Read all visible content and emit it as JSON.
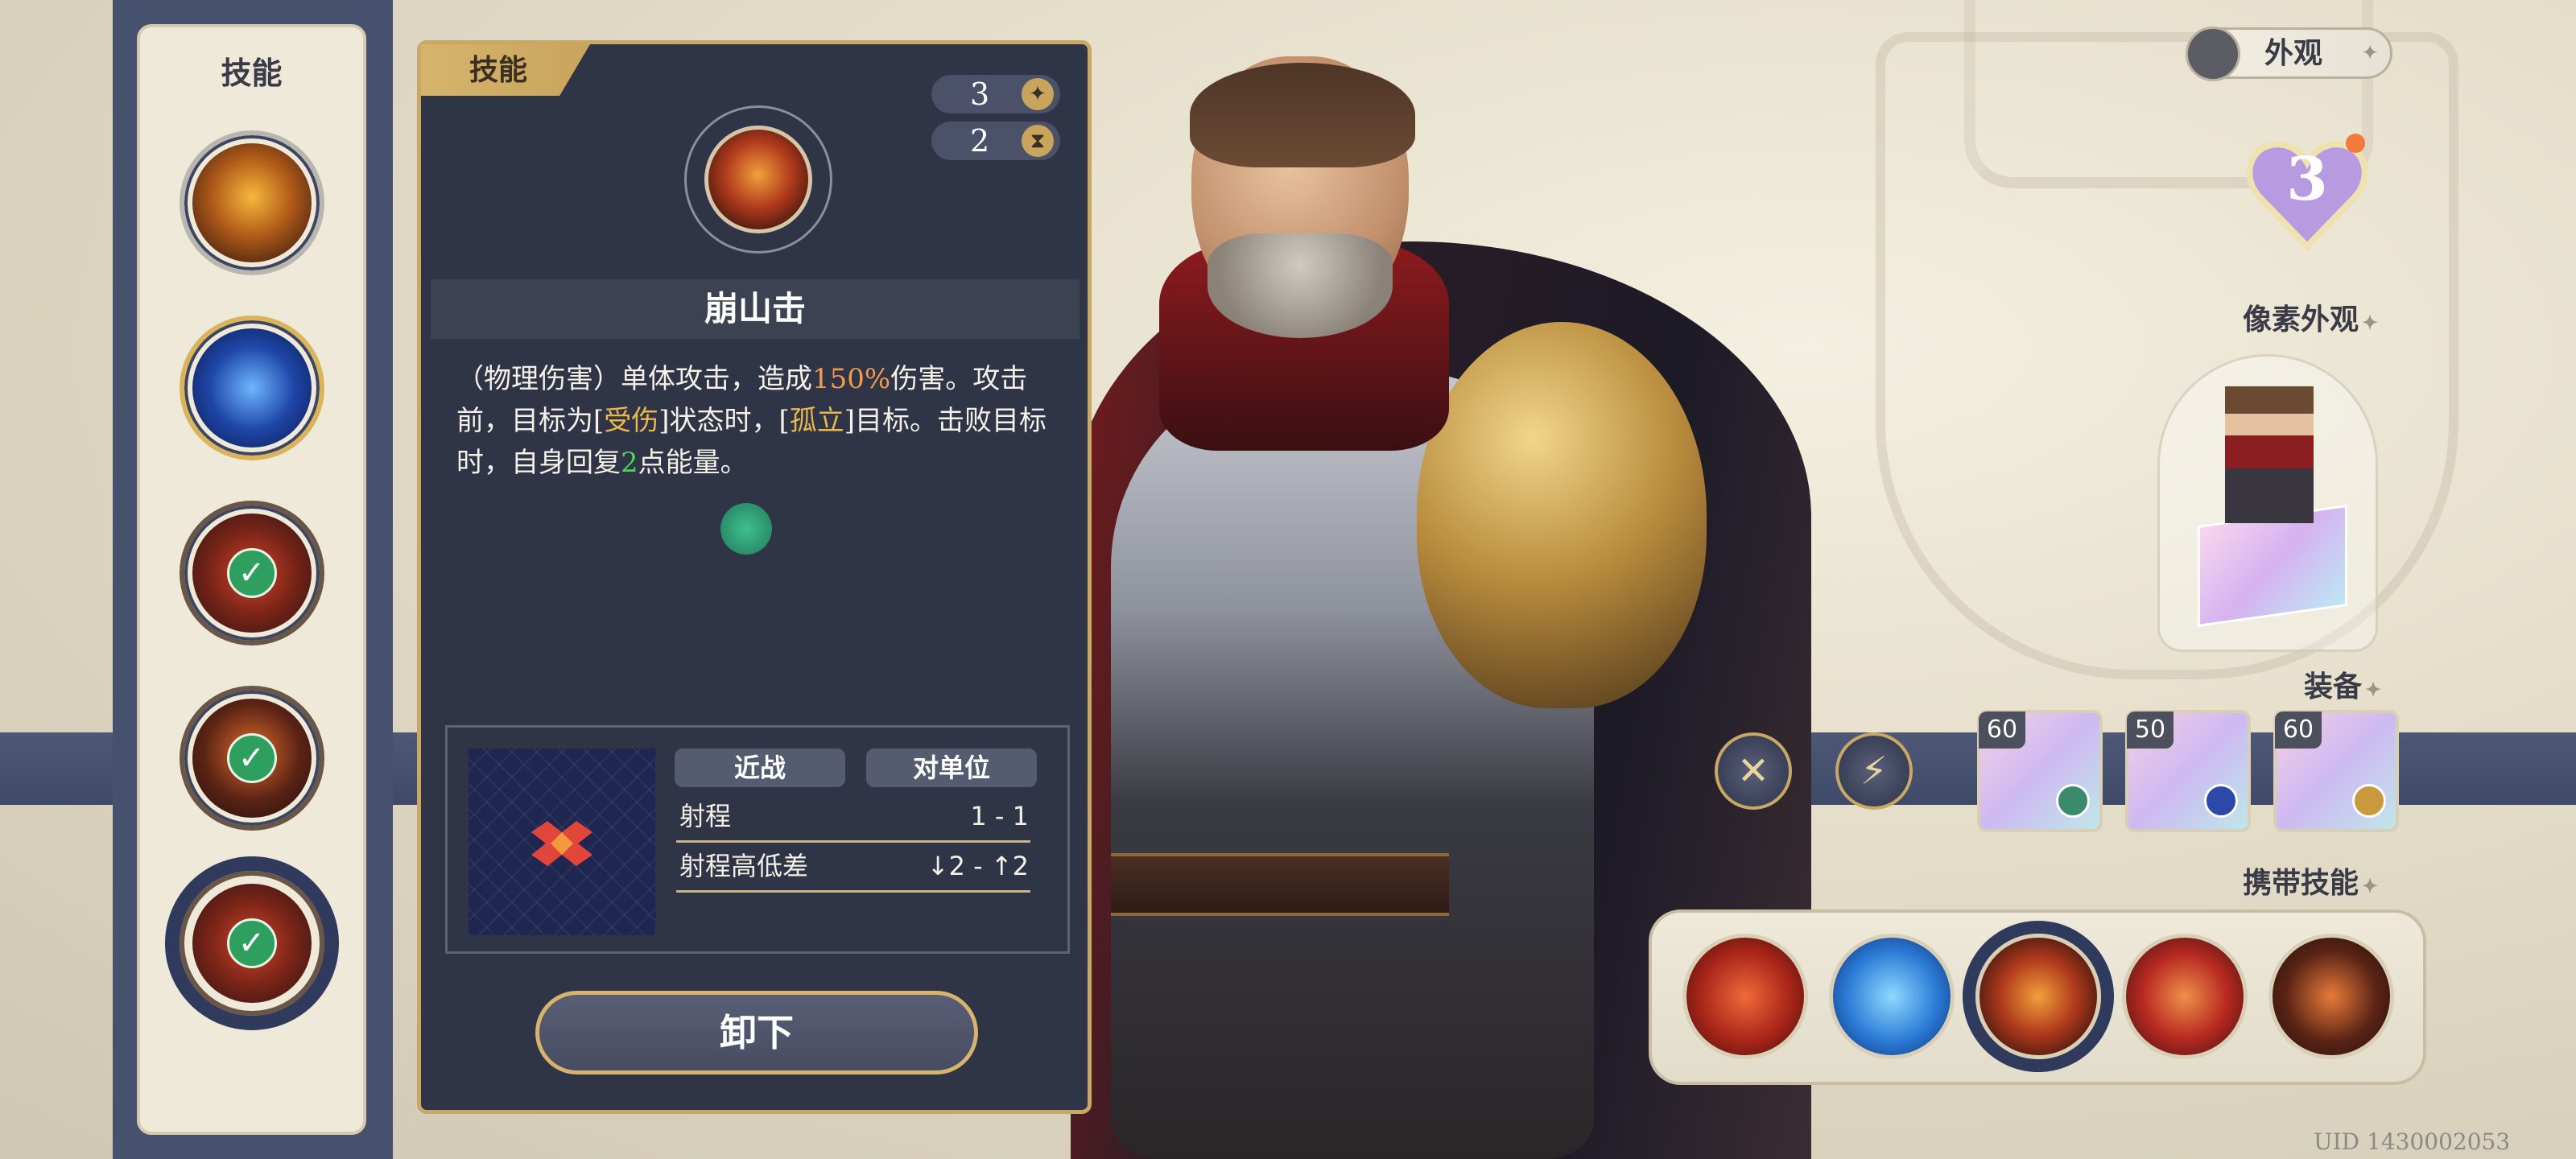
{
  "skill_list": {
    "title": "技能",
    "slots": [
      {
        "icon": "fire-strike-skill-icon",
        "equipped": false
      },
      {
        "icon": "blue-shield-skill-icon",
        "equipped": false
      },
      {
        "icon": "red-crest-skill-icon",
        "equipped": true
      },
      {
        "icon": "shadow-strike-skill-icon",
        "equipped": true
      },
      {
        "icon": "mountain-crash-skill-icon",
        "equipped": true,
        "selected": true
      }
    ],
    "check_glyph": "✓"
  },
  "detail": {
    "tab_label": "技能",
    "cost_value": "3",
    "cost_icon": "✦",
    "cooldown_value": "2",
    "cooldown_icon": "⧗",
    "skill_name": "崩山击",
    "description": {
      "p1": "（物理伤害）单体攻击，造成",
      "dmg": "150%",
      "p2": "伤害。攻击前，目标为[",
      "status1": "受伤",
      "p3": "]状态时，[",
      "status2": "孤立",
      "p4": "]目标。击败目标时，自身回复",
      "energy": "2",
      "p5": "点能量。"
    },
    "tags": [
      "近战",
      "对单位"
    ],
    "range_label": "射程",
    "range_value": "1 - 1",
    "height_label": "射程高低差",
    "height_value": "↓2 - ↑2",
    "unequip_label": "卸下"
  },
  "right": {
    "appearance_label": "外观",
    "appearance_spark": "✦",
    "heart_level": "3",
    "pixel_appearance_label": "像素外观",
    "equipment_label": "装备",
    "carry_skills_label": "携带技能",
    "label_spark": "✦",
    "equipment": [
      {
        "level": "60",
        "icon": "axe-weapon-icon"
      },
      {
        "level": "50",
        "icon": "ruby-amulet-icon"
      },
      {
        "level": "60",
        "icon": "jade-charm-icon"
      }
    ],
    "carry_skills": [
      {
        "icon": "red-gate-skill-icon"
      },
      {
        "icon": "blue-hex-skill-icon"
      },
      {
        "icon": "mountain-crash-skill-icon",
        "selected": true
      },
      {
        "icon": "red-crest-skill-icon"
      },
      {
        "icon": "shadow-strike-skill-icon"
      }
    ],
    "uid_text": "UID 1430002053"
  },
  "colors": {
    "panel_bg": "#2f3446",
    "gold_border": "#c8a864",
    "damage_highlight": "#f29a4d",
    "status_highlight": "#e8b84d",
    "energy_highlight": "#4fcf5e",
    "equipped_check": "#2e9f5e"
  }
}
